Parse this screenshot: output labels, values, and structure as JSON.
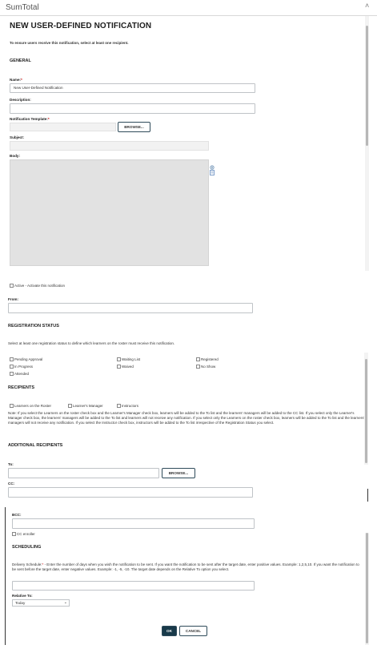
{
  "app": {
    "title": "SumTotal",
    "collapse_glyph": "˄"
  },
  "page": {
    "title": "NEW USER-DEFINED NOTIFICATION",
    "intro": "To ensure users receive this notification, select at least one recipient."
  },
  "general": {
    "heading": "GENERAL",
    "name_label": "Name:",
    "required_mark": "*",
    "name_value": "New User-Defined Notification",
    "description_label": "Description:",
    "template_label": "Notification Template:",
    "browse_label": "BROWSE...",
    "subject_label": "Subject:",
    "body_label": "Body:",
    "active_label": "Active - Activate this notification",
    "from_label": "From:"
  },
  "registration": {
    "heading": "REGISTRATION STATUS",
    "help": "Select at least one registration status to define which learners on the roster must receive this notification.",
    "statuses": [
      "Pending Approval",
      "Waiting List",
      "Registered",
      "In Progress",
      "Waived",
      "No Show",
      "Attended"
    ]
  },
  "recipients": {
    "heading": "RECIPIENTS",
    "options": [
      "Learners on the Roster",
      "Learner's Manager",
      "Instructors"
    ],
    "note": "Note: If you select the Learners on the roster check box and the Learner's Manager check box, learners will be added to the To list and the learners' managers will be added to the CC list. If you select only the Learner's Manager check box, the learners' managers will be added to the To list and learners will not receive any notification. If you select only the Learners on the roster check box, learners will be added to the To list and the learners' managers will not receive any notification. If you select the Instructor check box, instructors will be added to the To list irrespective of the Registration Status you select."
  },
  "additional": {
    "heading": "ADDITIONAL RECIPIENTS",
    "to_label": "To:",
    "browse_label": "BROWSE...",
    "cc_label": "CC:",
    "bcc_label": "BCC:",
    "cc_enroller_label": "CC enroller"
  },
  "scheduling": {
    "heading": "SCHEDULING",
    "delivery_label": "Delivery Schedule:",
    "delivery_help": "- Enter the number of days when you wish the notification to be sent. If you want the notification to be sent after the target date, enter positive values. Example: 1,2,5,10. If you want the notification to be sent before the target date, enter negative values. Example: -1, -5, -10. The target date depends on the Relative To option you select.",
    "relative_label": "Relative To:",
    "relative_value": "Today"
  },
  "footer": {
    "ok_label": "OK",
    "cancel_label": "CANCEL"
  },
  "colors": {
    "primary": "#183a4a",
    "border": "#bfc3c7",
    "readonly": "#f2f2f2",
    "body_area": "#e2e2e2"
  }
}
